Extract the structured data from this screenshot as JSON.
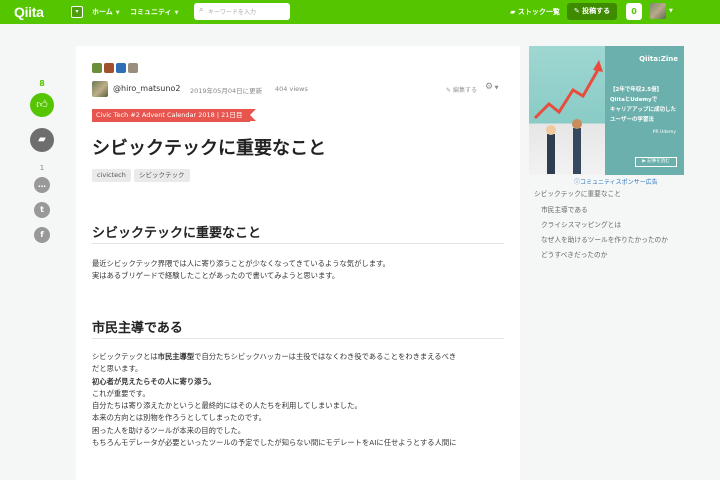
{
  "header": {
    "logo": "Qiita",
    "logo_dropdown": "▾",
    "nav": [
      {
        "label": "ホーム"
      },
      {
        "label": "コミュニティ"
      }
    ],
    "search_placeholder": "キーワードを入力",
    "stock_list": "ストック一覧",
    "post_button": "投稿する",
    "notification_count": "0"
  },
  "rail": {
    "like_count": "8",
    "comment_count": "1"
  },
  "article": {
    "author": "@hiro_matsuno2",
    "updated": "2019年05月04日に更新",
    "views": "404 views",
    "edit_request": "編集する",
    "advent_calendar": "Civic Tech #2 Advent Calendar 2018 | 21日目",
    "title": "シビックテックに重要なこと",
    "tags": [
      "civictech",
      "シビックテック"
    ],
    "sections": [
      {
        "heading": "シビックテックに重要なこと",
        "lines": [
          "最近シビックテック界隈では人に寄り添うことが少なくなってきているような気がします。",
          "実はあるブリゲードで経験したことがあったので書いてみようと思います。"
        ]
      },
      {
        "heading": "市民主導である",
        "p1_pre": "シビックテックとは",
        "p1_bold": "市民主導型",
        "p1_post": "で自分たちシビックハッカーは主役ではなくわき役であることをわきまえるべき",
        "p1_cont": "だと思います。",
        "bold_line": "初心者が見えたらその人に寄り添う。",
        "lines": [
          "これが重要です。",
          "自分たちは寄り添えたかというと最終的にはその人たちを利用してしまいました。",
          "本来の方向とは別物を作ろうとしてしまったのです。",
          "困った人を助けるツールが本来の目的でした。",
          "もちろんモデレータが必要といったツールの予定でしたが知らない間にモデレートをAIに任せようとする人間に"
        ]
      }
    ]
  },
  "sidebar": {
    "ad": {
      "brand": "Qiita:Zine",
      "lines": [
        "【2年で年収2.5倍】",
        "QiitaとUdemyで",
        "キャリアアップに成功した",
        "ユーザーの学習法"
      ],
      "pr": "PR Udemy",
      "cta": "記事を読む"
    },
    "sponsor_link": "コミュニティスポンサー広告",
    "toc": [
      {
        "label": "シビックテックに重要なこと"
      },
      {
        "label": "市民主導である"
      },
      {
        "label": "クライシスマッピングとは"
      },
      {
        "label": "なぜ人を助けるツールを作りたかったのか"
      },
      {
        "label": "どうすべきだったのか"
      }
    ]
  },
  "colors": {
    "brand": "#55c500",
    "ribbon": "#e8554e",
    "link": "#2b78c3"
  }
}
